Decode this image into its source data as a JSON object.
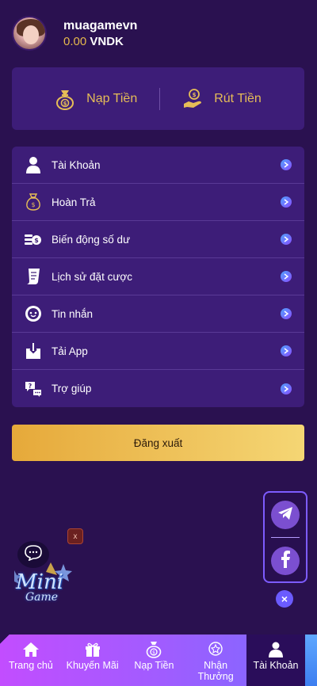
{
  "user": {
    "username": "muagamevn",
    "balance_amount": "0.00",
    "balance_currency": "VNDK"
  },
  "money_actions": {
    "deposit_label": "Nạp Tiền",
    "withdraw_label": "Rút Tiền"
  },
  "menu": {
    "items": [
      {
        "label": "Tài Khoản",
        "icon": "user-icon"
      },
      {
        "label": "Hoàn Trả",
        "icon": "money-bag-icon"
      },
      {
        "label": "Biến động số dư",
        "icon": "coins-icon"
      },
      {
        "label": "Lịch sử đặt cược",
        "icon": "receipt-icon"
      },
      {
        "label": "Tin nhắn",
        "icon": "message-icon"
      },
      {
        "label": "Tải App",
        "icon": "download-icon"
      },
      {
        "label": "Trợ giúp",
        "icon": "help-chat-icon"
      }
    ]
  },
  "logout_label": "Đăng xuất",
  "social": {
    "telegram_icon": "telegram-icon",
    "facebook_icon": "facebook-icon"
  },
  "mini_game": {
    "line1": "Mini",
    "line2": "Game",
    "close_label": "x"
  },
  "bottom_nav": {
    "items": [
      {
        "label": "Trang chủ",
        "icon": "home-icon"
      },
      {
        "label": "Khuyến Mãi",
        "icon": "gift-icon"
      },
      {
        "label": "Nạp Tiền",
        "icon": "deposit-icon"
      },
      {
        "label": "Nhận Thưởng",
        "icon": "badge-icon"
      },
      {
        "label": "Tài Khoản",
        "icon": "user-icon",
        "active": true
      }
    ]
  },
  "colors": {
    "background": "#2a1150",
    "card": "#3d1d78",
    "gold": "#e6bd57",
    "nav_gradient_start": "#c24dff",
    "nav_gradient_end": "#7a6bff"
  }
}
